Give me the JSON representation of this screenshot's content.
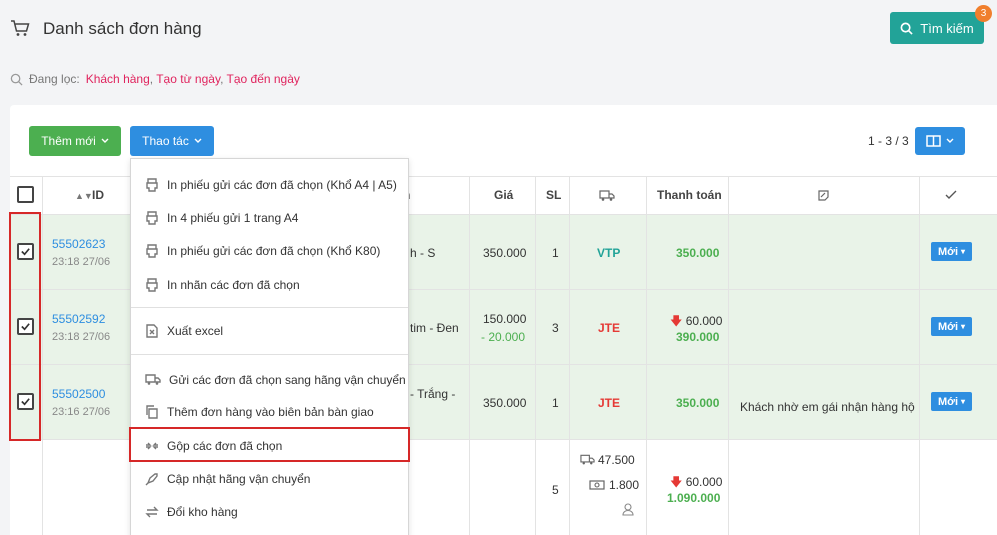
{
  "header": {
    "title": "Danh sách đơn hàng",
    "search_label": "Tìm kiếm",
    "search_badge": "3"
  },
  "filter": {
    "prefix": "Đang lọc:",
    "items": [
      "Khách hàng",
      "Tạo từ ngày",
      "Tạo đến ngày"
    ]
  },
  "toolbar": {
    "add_label": "Thêm mới",
    "action_label": "Thao tác",
    "pager": "1 - 3 / 3"
  },
  "table": {
    "headers": {
      "id": "ID",
      "product": "n",
      "price": "Giá",
      "qty": "SL",
      "payment": "Thanh toán"
    },
    "rows": [
      {
        "id": "55502623",
        "date": "23:18 27/06",
        "product": "h - S",
        "price": "350.000",
        "qty": "1",
        "shipper": "VTP",
        "discount": "",
        "payment": "350.000",
        "note": "",
        "status": "Mới"
      },
      {
        "id": "55502592",
        "date": "23:18 27/06",
        "product": "tim - Đen",
        "price": "150.000",
        "price_discount": "- 20.000",
        "qty": "3",
        "shipper": "JTE",
        "discount": "60.000",
        "payment": "390.000",
        "note": "",
        "status": "Mới"
      },
      {
        "id": "55502500",
        "date": "23:16 27/06",
        "product_line1": "- Trắng -",
        "product_line2": "",
        "price": "350.000",
        "qty": "1",
        "shipper": "JTE",
        "discount": "",
        "payment": "350.000",
        "note": "Khách nhờ em gái nhận hàng hộ",
        "status": "Mới"
      }
    ],
    "summary": {
      "qty": "5",
      "ship_fee": "47.500",
      "cod_fee": "1.800",
      "discount": "60.000",
      "payment": "1.090.000"
    }
  },
  "dropdown": {
    "items": [
      {
        "icon": "printer-icon",
        "label": "In phiếu gửi các đơn đã chọn (Khổ A4 | A5)"
      },
      {
        "icon": "printer-icon",
        "label": "In 4 phiếu gửi 1 trang A4"
      },
      {
        "icon": "printer-icon",
        "label": "In phiếu gửi các đơn đã chọn (Khổ K80)"
      },
      {
        "icon": "printer-icon",
        "label": "In nhãn các đơn đã chọn"
      },
      {
        "icon": "excel-icon",
        "label": "Xuất excel"
      },
      {
        "icon": "truck-icon",
        "label": "Gửi các đơn đã chọn sang hãng vận chuyển"
      },
      {
        "icon": "copy-icon",
        "label": "Thêm đơn hàng vào biên bản bàn giao"
      },
      {
        "icon": "merge-icon",
        "label": "Gộp các đơn đã chọn"
      },
      {
        "icon": "rocket-icon",
        "label": "Cập nhật hãng vận chuyển"
      },
      {
        "icon": "swap-icon",
        "label": "Đổi kho hàng"
      }
    ]
  },
  "colors": {
    "accent_teal": "#22a398",
    "accent_blue": "#2e8ee0",
    "accent_green": "#4caf50",
    "highlight_red": "#d62828"
  }
}
